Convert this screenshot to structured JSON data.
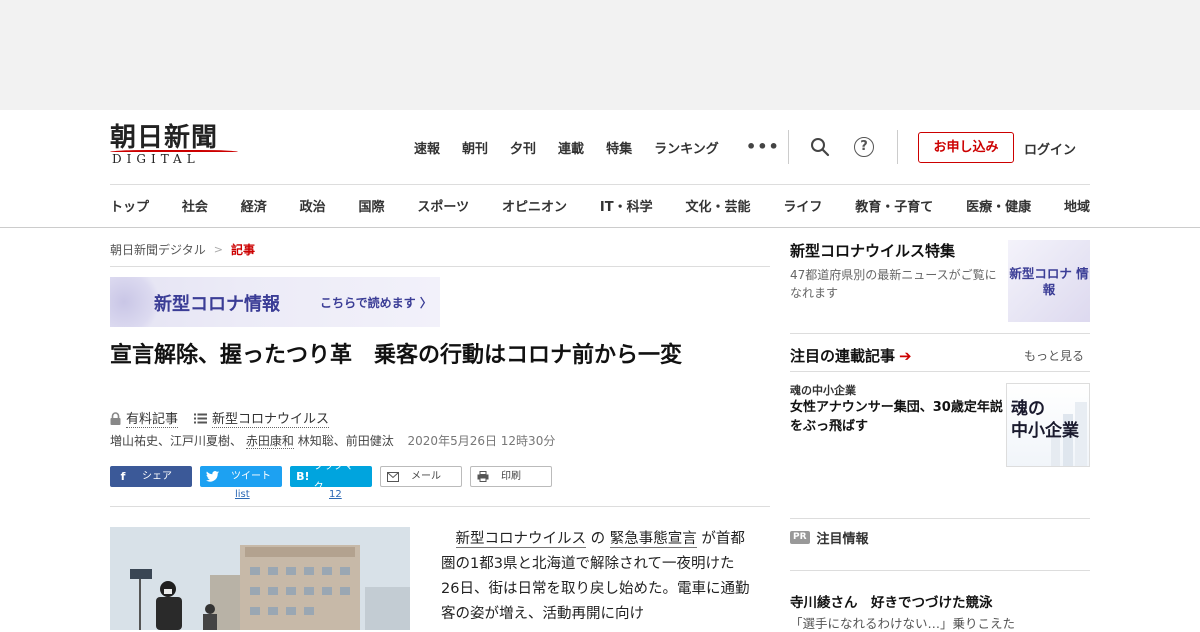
{
  "logo": {
    "kanji": "朝日新聞",
    "sub": "DIGITAL"
  },
  "topnav": [
    "速報",
    "朝刊",
    "夕刊",
    "連載",
    "特集",
    "ランキング"
  ],
  "more_label": "•••",
  "help_glyph": "?",
  "apply_label": "お申し込み",
  "login_label": "ログイン",
  "categories": [
    "トップ",
    "社会",
    "経済",
    "政治",
    "国際",
    "スポーツ",
    "オピニオン",
    "IT・科学",
    "文化・芸能",
    "ライフ",
    "教育・子育て",
    "医療・健康",
    "地域"
  ],
  "breadcrumb": {
    "home": "朝日新聞デジタル",
    "separator": ">",
    "current": "記事"
  },
  "corona_banner": {
    "title": "新型コロナ情報",
    "link": "こちらで読めます 〉"
  },
  "article": {
    "headline": "宣言解除、握ったつり革　乗客の行動はコロナ前から一変",
    "paid_label": "有料記事",
    "topic_label": "新型コロナウイルス",
    "authors_pre": "増山祐史、江戸川夏樹、",
    "author_link": "赤田康和",
    "authors_post": "林知聡、前田健汰",
    "date": "2020年5月26日 12時30分",
    "body_link1": "新型コロナウイルス",
    "body_mid1": " の ",
    "body_link2": "緊急事態宣言",
    "body_rest": " が首都圏の1都3県と北海道で解除されて一夜明けた26日、街は日常を取り戻し始めた。電車に通勤客の姿が増え、活動再開に向け"
  },
  "share": {
    "facebook": "シェア",
    "twitter": "ツイート",
    "hatena": "ブックマーク",
    "hatena_glyph": "B!",
    "mail": "メール",
    "print": "印刷",
    "twitter_count": "list",
    "hatena_count": "12"
  },
  "sidebar": {
    "feature_title": "新型コロナウイルス特集",
    "feature_desc": "47都道府県別の最新ニュースがご覧になれます",
    "feature_thumb": "新型コロナ 情報",
    "rensai_title": "注目の連載記事",
    "rensai_arrow": "➔",
    "rensai_more": "もっと見る",
    "rensai_kicker": "魂の中小企業",
    "rensai_headline": "女性アナウンサー集団、30歳定年説をぶっ飛ばす",
    "rensai_thumb_line1": "魂の",
    "rensai_thumb_line2": "中小企業",
    "pr_badge": "PR",
    "pr_heading": "注目情報",
    "pr_title": "寺川綾さん　好きでつづけた競泳",
    "pr_sub": "「選手になれるわけない…」乗りこえた"
  },
  "colors": {
    "brand_red": "#cc0000",
    "corona_navy": "#3b3d96",
    "facebook": "#3b5998",
    "twitter": "#1da1f2",
    "hatena": "#00a4de"
  }
}
